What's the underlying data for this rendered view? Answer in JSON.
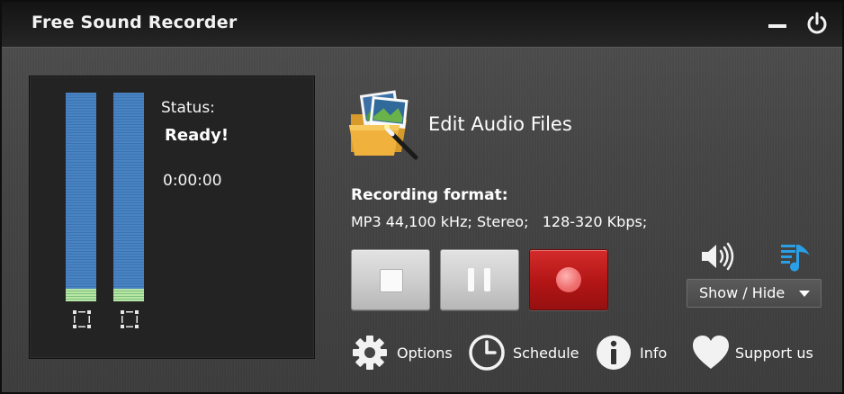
{
  "window": {
    "title": "Free Sound Recorder"
  },
  "titlebar": {
    "minimize_icon": "minimize-icon",
    "power_icon": "power-icon"
  },
  "meter": {
    "left_level": 1.0,
    "right_level": 1.0,
    "left_select_icon": "select-frame-icon",
    "right_select_icon": "select-frame-icon",
    "status_label": "Status:",
    "status_value": "Ready!",
    "time": "0:00:00"
  },
  "edit": {
    "label": "Edit Audio Files",
    "icon": "folder-pictures-wand-icon"
  },
  "format": {
    "title": "Recording format:",
    "value": "MP3 44,100 kHz; Stereo;   128-320 Kbps;"
  },
  "controls": {
    "stop_icon": "stop-icon",
    "pause_icon": "pause-icon",
    "record_icon": "record-icon",
    "record_color": "#b21515"
  },
  "mixer": {
    "speaker_icon": "speaker-icon",
    "music_icon": "music-note-icon",
    "music_color": "#2a9fe6",
    "show_hide_label": "Show / Hide"
  },
  "bottom": [
    {
      "label": "Options",
      "icon": "gear-icon"
    },
    {
      "label": "Schedule",
      "icon": "clock-icon"
    },
    {
      "label": "Info",
      "icon": "info-icon"
    },
    {
      "label": "Support us",
      "icon": "heart-icon"
    }
  ]
}
